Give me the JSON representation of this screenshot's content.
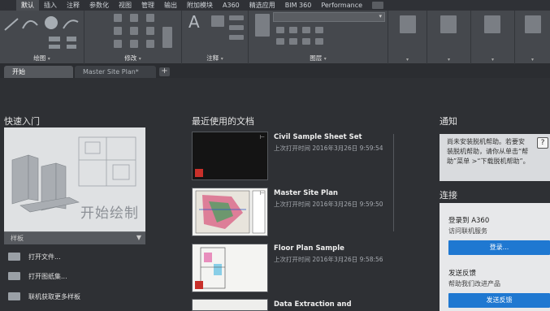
{
  "menubar": {
    "items": [
      "默认",
      "插入",
      "注释",
      "参数化",
      "视图",
      "管理",
      "输出",
      "附加模块",
      "A360",
      "精选应用",
      "BIM 360",
      "Performance"
    ]
  },
  "ribbon": {
    "panels": [
      "绘图",
      "修改",
      "注释",
      "图层"
    ],
    "dropdown_glyph": "▾"
  },
  "tabs": {
    "items": [
      "开始",
      "Master Site Plan*"
    ],
    "add": "+"
  },
  "quickstart": {
    "title": "快速入门",
    "start_label": "开始绘制",
    "template_label": "样板",
    "template_arrow": "▼",
    "actions": [
      "打开文件...",
      "打开图纸集...",
      "联机获取更多样板"
    ]
  },
  "recent": {
    "title": "最近使用的文档",
    "docs": [
      {
        "name": "Civil Sample Sheet Set",
        "opened": "上次打开时间 2016年3月26日 9:59:54"
      },
      {
        "name": "Master Site Plan",
        "opened": "上次打开时间 2016年3月26日 9:59:50"
      },
      {
        "name": "Floor Plan Sample",
        "opened": "上次打开时间 2016年3月26日 9:58:56"
      },
      {
        "name": "Data Extraction and",
        "opened": ""
      }
    ]
  },
  "notifications": {
    "title": "通知",
    "message": "尚未安装脱机帮助。若要安装脱机帮助，请你从单击“帮助”菜单 >“下载脱机帮助”。",
    "help_icon": "?"
  },
  "connect": {
    "title": "连接",
    "login_title": "登录到 A360",
    "login_sub": "访问联机服务",
    "login_button": "登录...",
    "feedback_title": "发送反馈",
    "feedback_sub": "帮助我们改进产品",
    "feedback_button": "发送反馈"
  }
}
